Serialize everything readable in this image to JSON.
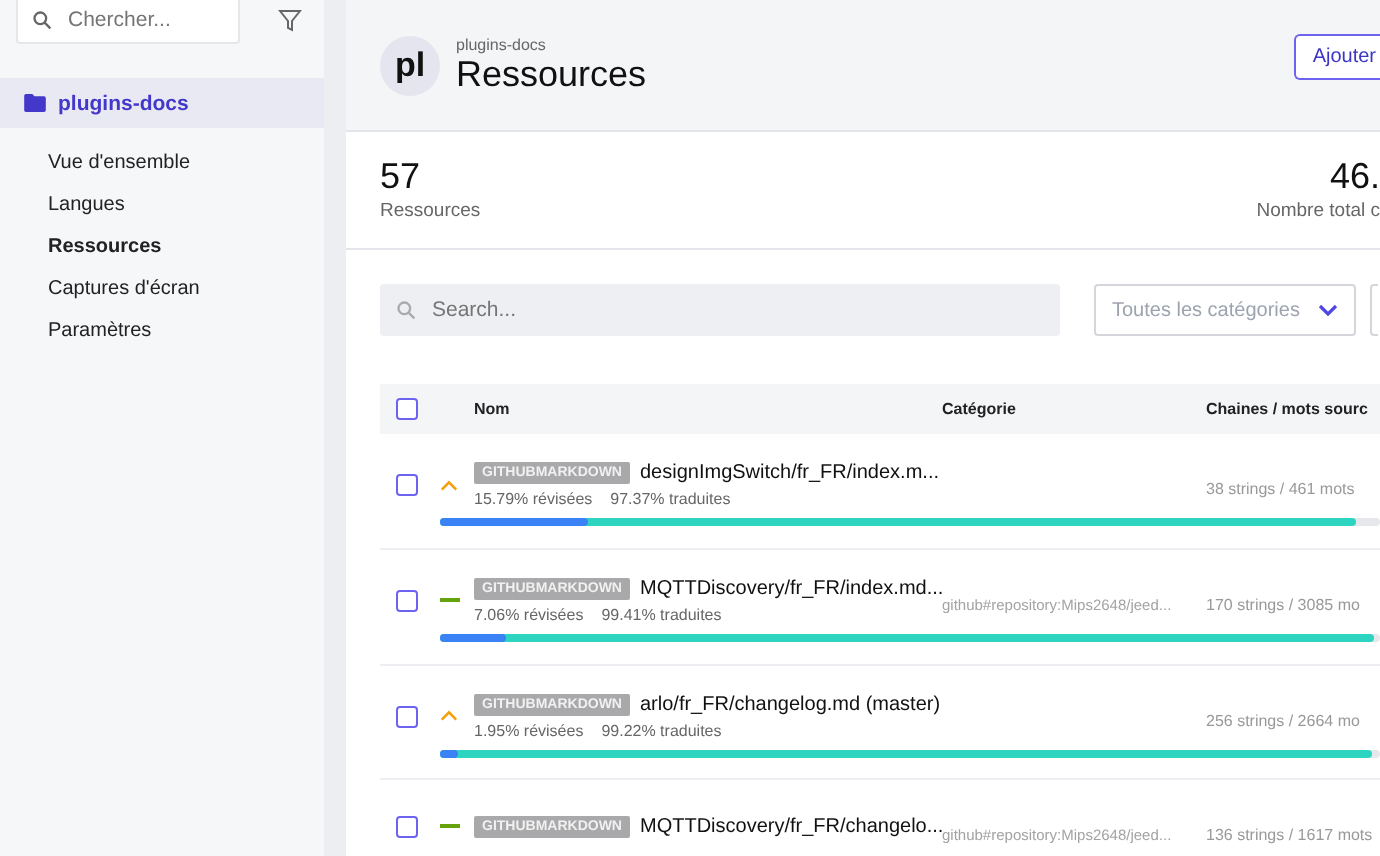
{
  "sidebar": {
    "search": {
      "placeholder": "Chercher..."
    },
    "project": {
      "label": "plugins-docs",
      "selected": true
    },
    "items": [
      {
        "label": "Vue d'ensemble",
        "selected": false
      },
      {
        "label": "Langues",
        "selected": false
      },
      {
        "label": "Ressources",
        "selected": true
      },
      {
        "label": "Captures d'écran",
        "selected": false
      },
      {
        "label": "Paramètres",
        "selected": false
      }
    ]
  },
  "header": {
    "avatar": "pl",
    "breadcrumb": "plugins-docs",
    "title": "Ressources",
    "button": "Ajouter"
  },
  "stats": [
    {
      "value": "57",
      "label": "Ressources"
    },
    {
      "value": "46.",
      "label": "Nombre total c"
    }
  ],
  "toolbar": {
    "search": {
      "placeholder": "Search..."
    },
    "category": {
      "placeholder": "Toutes les catégories"
    }
  },
  "table": {
    "all_checked": false,
    "columns": [
      "Nom",
      "Catégorie",
      "Chaines / mots sourc"
    ],
    "rows": [
      {
        "checked": false,
        "kind": "high",
        "badge": "GITHUBMARKDOWN",
        "name": "designImgSwitch/fr_FR/index.m...",
        "reviewed": "15.79% révisées",
        "translated": "97.37% traduites",
        "category": "",
        "counts": "38 strings / 461 mots",
        "reviewed_bar": {
          "level": 0.1579
        },
        "translated_bar": {
          "level": 0.9737
        }
      },
      {
        "checked": false,
        "kind": "normal",
        "badge": "GITHUBMARKDOWN",
        "name": "MQTTDiscovery/fr_FR/index.md...",
        "reviewed": "7.06% révisées",
        "translated": "99.41% traduites",
        "category": "github#repository:Mips2648/jeed...",
        "counts": "170 strings / 3085 mo",
        "reviewed_bar": {
          "level": 0.0706
        },
        "translated_bar": {
          "level": 0.9941
        }
      },
      {
        "checked": false,
        "kind": "high",
        "badge": "GITHUBMARKDOWN",
        "name": "arlo/fr_FR/changelog.md (master)",
        "reviewed": "1.95% révisées",
        "translated": "99.22% traduites",
        "category": "",
        "counts": "256 strings / 2664 mo",
        "reviewed_bar": {
          "level": 0.0195
        },
        "translated_bar": {
          "level": 0.9922
        }
      },
      {
        "checked": false,
        "kind": "normal",
        "badge": "GITHUBMARKDOWN",
        "name": "MQTTDiscovery/fr_FR/changelo...",
        "category": "github#repository:Mips2648/jeed...",
        "counts": "136 strings / 1617 mots"
      }
    ]
  }
}
